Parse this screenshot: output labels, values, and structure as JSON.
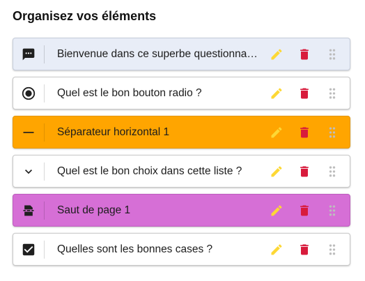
{
  "header": {
    "title": "Organisez vos éléments"
  },
  "colors": {
    "edit": "#fdd835",
    "delete": "#d81b3c",
    "drag": "#bdbdbd",
    "welcome_bg": "#e8edf7",
    "separator_bg": "#ffa500",
    "pagebreak_bg": "#d66fd6"
  },
  "items": [
    {
      "type": "welcome",
      "icon": "comment-icon",
      "label": "Bienvenue dans ce superbe questionnaire !"
    },
    {
      "type": "radio",
      "icon": "radio-button-icon",
      "label": "Quel est le bon bouton radio ?"
    },
    {
      "type": "separator",
      "icon": "horizontal-rule-icon",
      "label": "Séparateur horizontal 1"
    },
    {
      "type": "select",
      "icon": "chevron-down-icon",
      "label": "Quel est le bon choix dans cette liste ?"
    },
    {
      "type": "pagebreak",
      "icon": "page-break-icon",
      "label": "Saut de page 1"
    },
    {
      "type": "checkbox",
      "icon": "checkbox-icon",
      "label": "Quelles sont les bonnes cases ?"
    }
  ]
}
